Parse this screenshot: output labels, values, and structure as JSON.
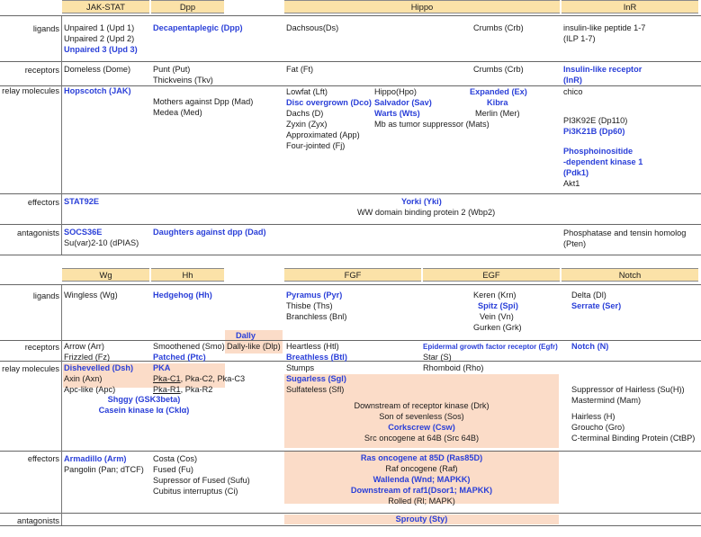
{
  "table1": {
    "headers": [
      "JAK-STAT",
      "Dpp",
      "Hippo",
      "InR"
    ],
    "row_labels": [
      "ligands",
      "receptors",
      "relay molecules",
      "effectors",
      "antagonists"
    ],
    "ligands": {
      "jak": [
        "Unpaired 1 (Upd 1)",
        "Unpaired 2 (Upd 2)",
        "Unpaired 3 (Upd 3)"
      ],
      "dpp": [
        "Decapentaplegic (Dpp)"
      ],
      "hippo_a": "Dachsous(Ds)",
      "hippo_b": "Crumbs (Crb)",
      "inr": [
        "insulin-like peptide 1-7",
        "(ILP 1-7)"
      ]
    },
    "receptors": {
      "jak": "Domeless (Dome)",
      "dpp": [
        "Punt (Put)",
        "Thickveins (Tkv)"
      ],
      "hippo_a": "Fat (Ft)",
      "hippo_b": "Crumbs (Crb)",
      "inr": [
        "Insulin-like receptor",
        "(InR)"
      ]
    },
    "relay": {
      "jak": "Hopscotch (JAK)",
      "dpp": [
        "Mothers against Dpp (Mad)",
        "Medea (Med)"
      ],
      "hippo_a": [
        "Lowfat (Lft)",
        "Disc overgrown (Dco)",
        "Dachs (D)",
        "Zyxin (Zyx)",
        "Approximated (App)",
        "Four-jointed (Fj)"
      ],
      "hippo_b": [
        "Hippo(Hpo)",
        "Salvador (Sav)",
        "Warts (Wts)",
        "Mb as tumor suppressor (Mats)"
      ],
      "hippo_c": [
        "Expanded (Ex)",
        "Kibra",
        "Merlin (Mer)"
      ],
      "inr": [
        "chico",
        "PI3K92E (Dp110)",
        "Pi3K21B (Dp60)",
        "Phosphoinositide",
        "-dependent kinase 1",
        "(Pdk1)",
        "Akt1"
      ]
    },
    "effectors": {
      "jak": "STAT92E",
      "hippo": [
        "Yorki (Yki)",
        "WW domain binding protein 2 (Wbp2)"
      ]
    },
    "antagonists": {
      "jak": [
        "SOCS36E",
        "Su(var)2-10 (dPIAS)"
      ],
      "dpp": "Daughters against dpp (Dad)",
      "inr": [
        "Phosphatase and tensin homolog",
        "(Pten)"
      ]
    }
  },
  "table2": {
    "headers": [
      "Wg",
      "Hh",
      "FGF",
      "EGF",
      "Notch"
    ],
    "row_labels": [
      "ligands",
      "receptors",
      "relay molecules",
      "effectors",
      "antagonists"
    ],
    "ligands": {
      "wg": "Wingless (Wg)",
      "hh": "Hedgehog (Hh)",
      "fgf": [
        "Pyramus (Pyr)",
        "Thisbe (Ths)",
        "Branchless (Bnl)"
      ],
      "egf": [
        "Keren (Krn)",
        "Spitz (Spi)",
        "Vein (Vn)",
        "Gurken (Grk)"
      ],
      "notch": [
        "Delta (Dl)",
        "Serrate (Ser)"
      ]
    },
    "receptors": {
      "wg": [
        "Arrow (Arr)",
        "Frizzled (Fz)"
      ],
      "hh": [
        "Smoothened (Smo)",
        "Patched (Ptc)"
      ],
      "dally": [
        "Dally",
        "Dally-like (Dlp)"
      ],
      "fgf": [
        "Heartless (Htl)",
        "Breathless (Btl)"
      ],
      "egf": [
        "Epidermal growth factor receptor (Egfr)",
        "Star (S)"
      ],
      "notch": "Notch (N)"
    },
    "relay": {
      "wg": [
        "Dishevelled (Dsh)",
        "Axin (Axn)",
        "Apc-like (Apc)"
      ],
      "hh": [
        "PKA",
        "Pka-C1",
        ", Pka-C2, Pka-C3",
        "Pka-R1",
        ", Pka-R2"
      ],
      "shared": [
        "Shggy (GSK3beta)",
        "Casein kinase Iα (CkIα)"
      ],
      "fgf": [
        "Stumps",
        "Sugarless (Sgl)",
        "Sulfateless (Sfl)"
      ],
      "egf": "Rhomboid (Rho)",
      "fgf_egf": [
        "Downstream of receptor kinase (Drk)",
        "Son of sevenless (Sos)",
        "Corkscrew (Csw)",
        "Src oncogene at 64B (Src 64B)"
      ],
      "notch": [
        "Suppressor of Hairless (Su(H))",
        "Mastermind (Mam)",
        "Hairless (H)",
        "Groucho (Gro)",
        "C-terminal Binding Protein (CtBP)"
      ]
    },
    "effectors": {
      "wg": [
        "Armadillo (Arm)",
        "Pangolin (Pan; dTCF)"
      ],
      "hh": [
        "Costa (Cos)",
        "Fused (Fu)",
        "Supressor of Fused (Sufu)",
        "Cubitus interruptus (Ci)"
      ],
      "fgf_egf": [
        "Ras oncogene at 85D (Ras85D)",
        "Raf oncogene (Raf)",
        "Wallenda (Wnd; MAPKK)",
        "Downstream of raf1(Dsor1; MAPKK)",
        "Rolled (Rl; MAPK)"
      ]
    },
    "antagonists": {
      "fgf_egf": "Sprouty (Sty)"
    }
  }
}
